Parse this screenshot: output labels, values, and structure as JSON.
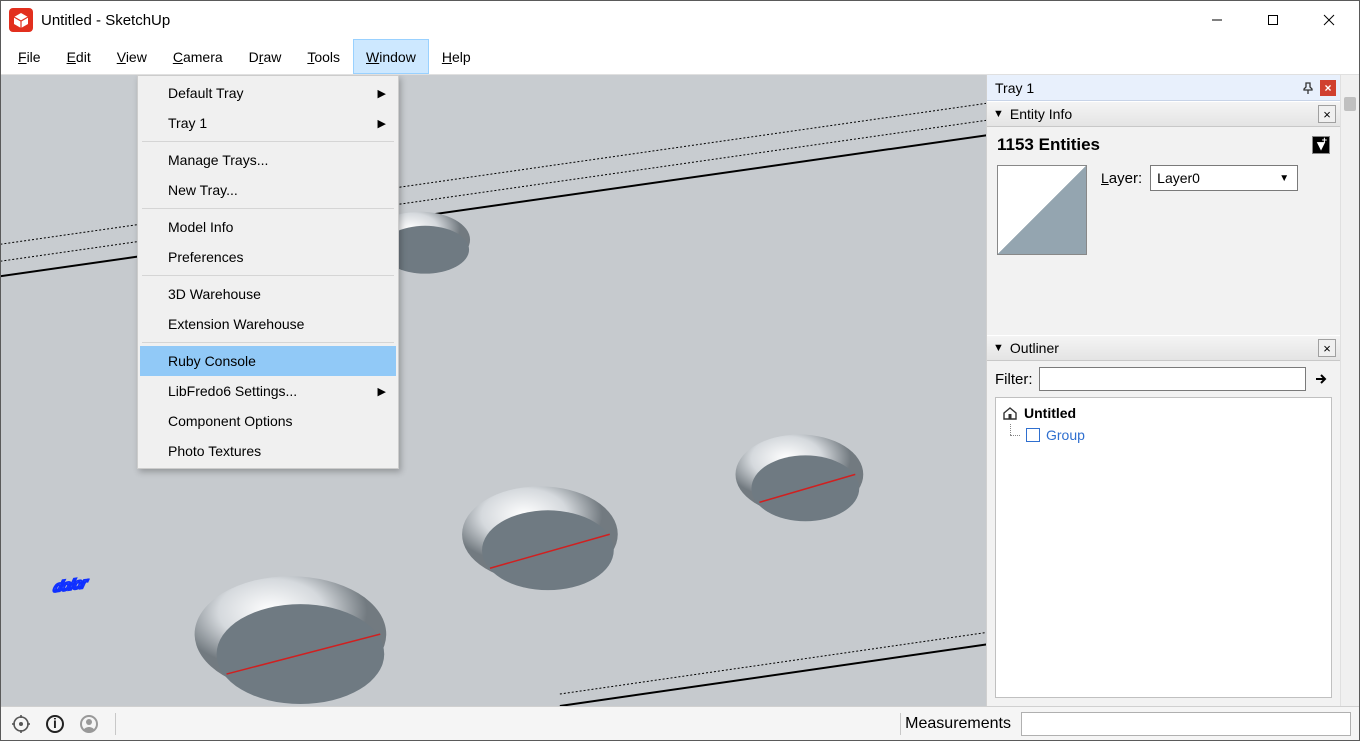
{
  "window": {
    "title": "Untitled - SketchUp"
  },
  "menu": {
    "file": "File",
    "edit": "Edit",
    "view": "View",
    "camera": "Camera",
    "draw": "Draw",
    "tools": "Tools",
    "window": "Window",
    "help": "Help"
  },
  "dropdown": {
    "default_tray": "Default Tray",
    "tray1": "Tray 1",
    "manage_trays": "Manage Trays...",
    "new_tray": "New Tray...",
    "model_info": "Model Info",
    "preferences": "Preferences",
    "warehouse_3d": "3D Warehouse",
    "extension_warehouse": "Extension Warehouse",
    "ruby_console": "Ruby Console",
    "libfredo6": "LibFredo6 Settings...",
    "component_options": "Component Options",
    "photo_textures": "Photo Textures"
  },
  "tray": {
    "title": "Tray 1",
    "entity_info": {
      "header": "Entity Info",
      "count_label": "1153 Entities",
      "layer_label": "Layer:",
      "layer_value": "Layer0"
    },
    "outliner": {
      "header": "Outliner",
      "filter_label": "Filter:",
      "filter_value": "",
      "root": "Untitled",
      "child": "Group"
    }
  },
  "status": {
    "measurements_label": "Measurements",
    "measurements_value": ""
  }
}
